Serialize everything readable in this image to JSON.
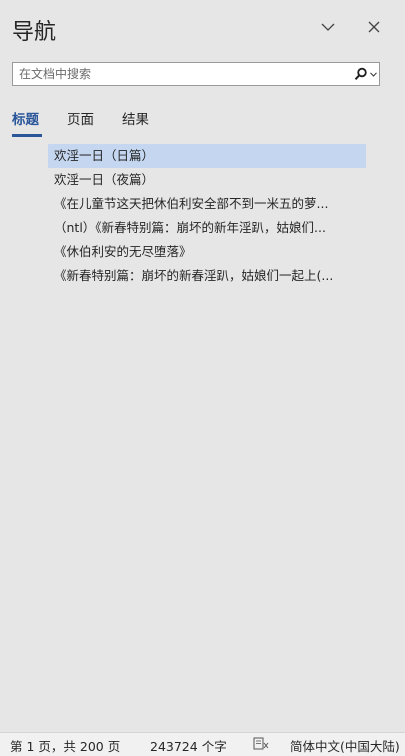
{
  "nav": {
    "title": "导航",
    "search_placeholder": "在文档中搜索",
    "tabs": [
      {
        "label": "标题",
        "active": true
      },
      {
        "label": "页面",
        "active": false
      },
      {
        "label": "结果",
        "active": false
      }
    ],
    "headings": [
      {
        "text": "欢淫一日（日篇）",
        "selected": true
      },
      {
        "text": "欢淫一日（夜篇）",
        "selected": false
      },
      {
        "text": "《在儿童节这天把休伯利安全部不到一米五的萝...",
        "selected": false
      },
      {
        "text": "（ntl）《新春特别篇：崩坏的新年淫趴，姑娘们...",
        "selected": false
      },
      {
        "text": "《休伯利安的无尽堕落》",
        "selected": false
      },
      {
        "text": "《新春特别篇：崩坏的新春淫趴，姑娘们一起上(...",
        "selected": false
      }
    ]
  },
  "status": {
    "page": "第 1 页，共 200 页",
    "words": "243724 个字",
    "language": "简体中文(中国大陆)"
  },
  "colors": {
    "accent": "#2b579a",
    "selected_bg": "#c5d7f0",
    "pane_bg": "#e6e6e6"
  }
}
